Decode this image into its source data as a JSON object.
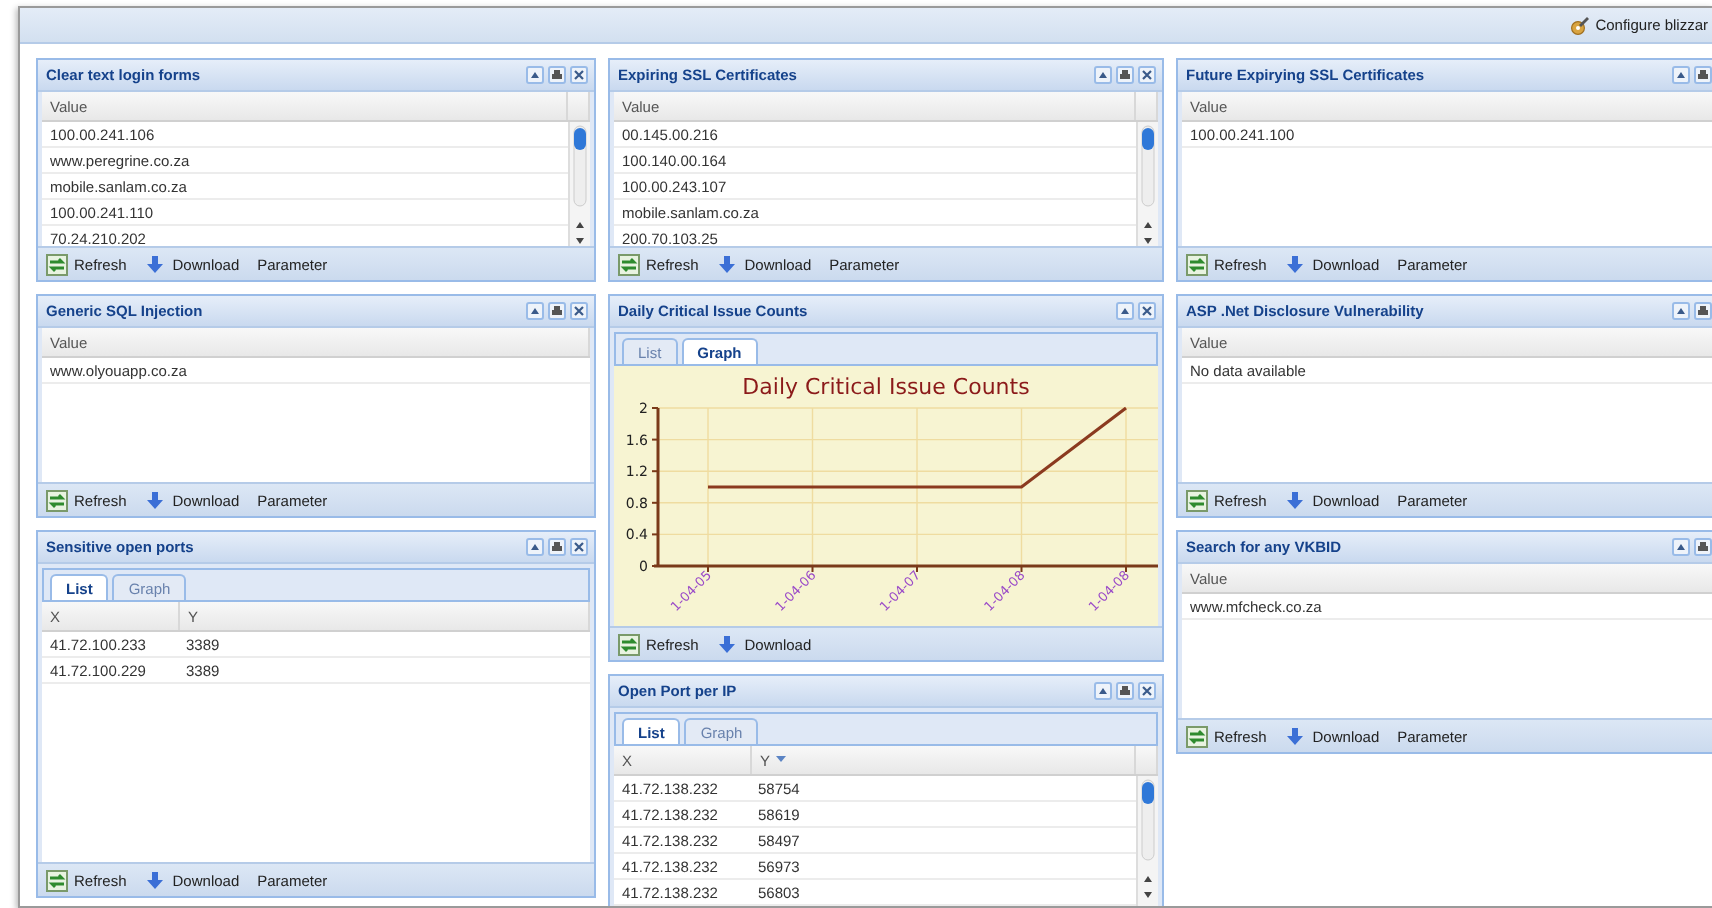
{
  "toolbar": {
    "configure_label": "Configure blizzar"
  },
  "columns": [
    {
      "panels": [
        {
          "title": "Clear text login forms",
          "printable": true,
          "closable": true,
          "grid": {
            "scrollbar": true,
            "columns": [
              {
                "label": "Value"
              }
            ],
            "rows": [
              [
                "100.00.241.106"
              ],
              [
                "www.peregrine.co.za"
              ],
              [
                "mobile.sanlam.co.za"
              ],
              [
                "100.00.241.110"
              ],
              [
                "70.24.210.202"
              ]
            ]
          },
          "actions": [
            {
              "kind": "refresh",
              "label": "Refresh"
            },
            {
              "kind": "download",
              "label": "Download"
            },
            {
              "kind": "parameter",
              "label": "Parameter"
            }
          ]
        },
        {
          "title": "Generic SQL Injection",
          "printable": true,
          "closable": true,
          "grid": {
            "scrollbar": false,
            "columns": [
              {
                "label": "Value"
              }
            ],
            "rows": [
              [
                "www.olyouapp.co.za"
              ]
            ]
          },
          "actions": [
            {
              "kind": "refresh",
              "label": "Refresh"
            },
            {
              "kind": "download",
              "label": "Download"
            },
            {
              "kind": "parameter",
              "label": "Parameter"
            }
          ]
        },
        {
          "title": "Sensitive open ports",
          "printable": true,
          "closable": true,
          "tabs": [
            {
              "label": "List",
              "selected": true
            },
            {
              "label": "Graph",
              "selected": false
            }
          ],
          "grid": {
            "scrollbar": false,
            "columns": [
              {
                "label": "X"
              },
              {
                "label": "Y"
              }
            ],
            "rows": [
              [
                "41.72.100.233",
                "3389"
              ],
              [
                "41.72.100.229",
                "3389"
              ]
            ]
          },
          "actions": [
            {
              "kind": "refresh",
              "label": "Refresh"
            },
            {
              "kind": "download",
              "label": "Download"
            },
            {
              "kind": "parameter",
              "label": "Parameter"
            }
          ]
        }
      ]
    },
    {
      "panels": [
        {
          "title": "Expiring SSL Certificates",
          "printable": true,
          "closable": true,
          "grid": {
            "scrollbar": true,
            "columns": [
              {
                "label": "Value"
              }
            ],
            "rows": [
              [
                "00.145.00.216"
              ],
              [
                "100.140.00.164"
              ],
              [
                "100.00.243.107"
              ],
              [
                "mobile.sanlam.co.za"
              ],
              [
                "200.70.103.25"
              ]
            ]
          },
          "actions": [
            {
              "kind": "refresh",
              "label": "Refresh"
            },
            {
              "kind": "download",
              "label": "Download"
            },
            {
              "kind": "parameter",
              "label": "Parameter"
            }
          ]
        },
        {
          "title": "Daily Critical Issue Counts",
          "printable": false,
          "closable": true,
          "tabs": [
            {
              "label": "List",
              "selected": false
            },
            {
              "label": "Graph",
              "selected": true
            }
          ],
          "chart_data": {
            "type": "line",
            "title": "Daily Critical Issue Counts",
            "grid": true,
            "categories": [
              "1-04-05",
              "1-04-06",
              "1-04-07",
              "1-04-08",
              "1-04-08"
            ],
            "series": [
              {
                "color": "#8b3a1f",
                "values": [
                  1,
                  1,
                  1,
                  1,
                  2
                ]
              }
            ],
            "ylim": [
              0,
              2
            ],
            "yticks": [
              0,
              0.4,
              0.8,
              1.2,
              1.6,
              2
            ]
          },
          "actions": [
            {
              "kind": "refresh",
              "label": "Refresh"
            },
            {
              "kind": "download",
              "label": "Download"
            }
          ]
        },
        {
          "title": "Open Port per IP",
          "printable": true,
          "closable": true,
          "tabs": [
            {
              "label": "List",
              "selected": true
            },
            {
              "label": "Graph",
              "selected": false
            }
          ],
          "grid": {
            "scrollbar": true,
            "columns": [
              {
                "label": "X",
                "sorted": false
              },
              {
                "label": "Y",
                "sorted": true
              }
            ],
            "rows": [
              [
                "41.72.138.232",
                "58754"
              ],
              [
                "41.72.138.232",
                "58619"
              ],
              [
                "41.72.138.232",
                "58497"
              ],
              [
                "41.72.138.232",
                "56973"
              ],
              [
                "41.72.138.232",
                "56803"
              ]
            ]
          }
        }
      ]
    },
    {
      "panels": [
        {
          "title": "Future Expirying SSL Certificates",
          "printable": true,
          "grid": {
            "scrollbar": false,
            "columns": [
              {
                "label": "Value"
              }
            ],
            "rows": [
              [
                "100.00.241.100"
              ]
            ]
          },
          "actions": [
            {
              "kind": "refresh",
              "label": "Refresh"
            },
            {
              "kind": "download",
              "label": "Download"
            },
            {
              "kind": "parameter",
              "label": "Parameter"
            }
          ]
        },
        {
          "title": "ASP .Net Disclosure Vulnerability",
          "printable": true,
          "grid": {
            "scrollbar": false,
            "columns": [
              {
                "label": "Value"
              }
            ],
            "rows": [
              [
                "No data available"
              ]
            ]
          },
          "actions": [
            {
              "kind": "refresh",
              "label": "Refresh"
            },
            {
              "kind": "download",
              "label": "Download"
            },
            {
              "kind": "parameter",
              "label": "Parameter"
            }
          ]
        },
        {
          "title": "Search for any VKBID",
          "printable": true,
          "grid": {
            "scrollbar": false,
            "columns": [
              {
                "label": "Value"
              }
            ],
            "rows": [
              [
                "www.mfcheck.co.za"
              ]
            ]
          },
          "actions": [
            {
              "kind": "refresh",
              "label": "Refresh"
            },
            {
              "kind": "download",
              "label": "Download"
            },
            {
              "kind": "parameter",
              "label": "Parameter"
            }
          ]
        }
      ]
    }
  ]
}
